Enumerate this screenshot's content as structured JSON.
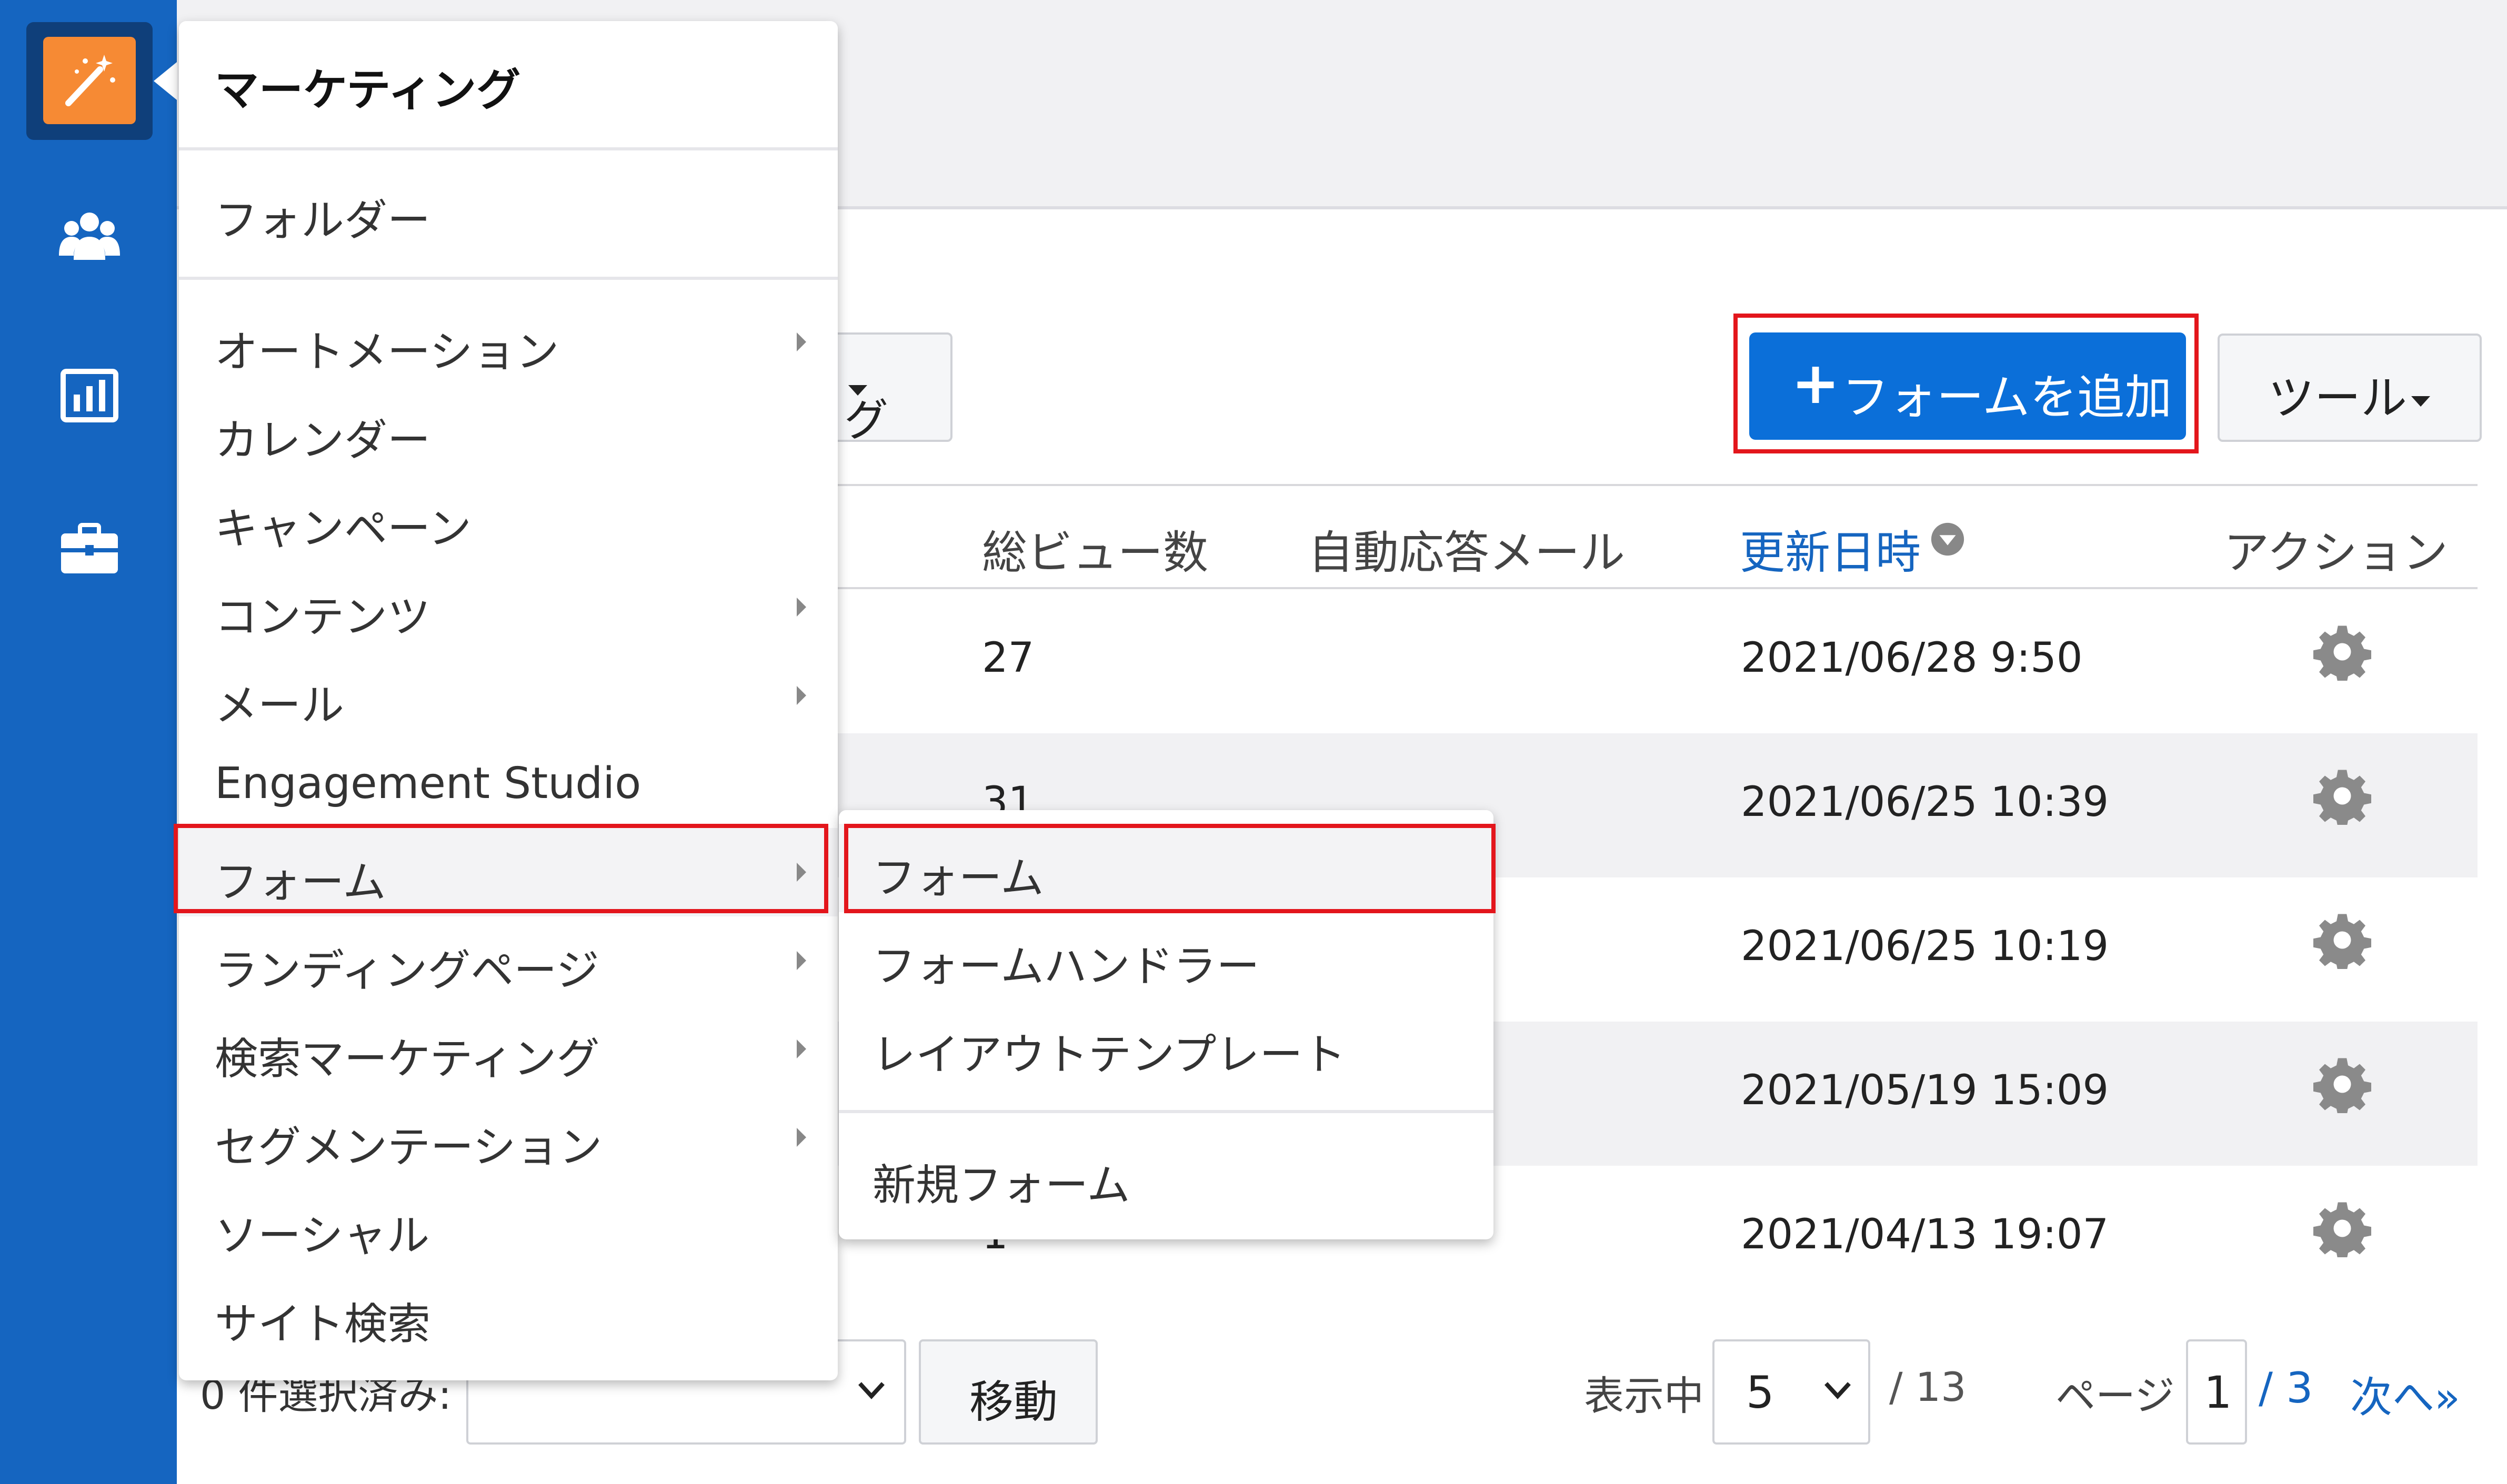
{
  "colors": {
    "rail": "#1565c0",
    "accent": "#0b6fd9",
    "logo": "#f68a34",
    "highlight": "#e3161c"
  },
  "rail": {
    "icons": [
      "marketing-wand-icon",
      "prospects-people-icon",
      "reports-chart-icon",
      "admin-briefcase-icon"
    ]
  },
  "toolbar": {
    "filter_tag_fragment": "グ",
    "add_form_plus": "+",
    "add_form_label": "フォームを追加",
    "tools_label": "ツール"
  },
  "table": {
    "headers": {
      "views": "総ビュー数",
      "autoresponder": "自動応答メール",
      "updated": "更新日時",
      "actions": "アクション"
    },
    "rows": [
      {
        "views": "27",
        "updated": "2021/06/28 9:50"
      },
      {
        "views": "31",
        "updated": "2021/06/25 10:39"
      },
      {
        "views": "",
        "updated": "2021/06/25 10:19"
      },
      {
        "views": "",
        "updated": "2021/05/19 15:09"
      },
      {
        "views": "1",
        "updated": "2021/04/13 19:07"
      }
    ]
  },
  "footer": {
    "selected_label": "0 件選択済み:",
    "move_label": "移動",
    "showing_label": "表示中",
    "per_page": "5",
    "total": "/ 13",
    "page_label": "ページ",
    "page_current": "1",
    "page_total": "/ 3",
    "next_label": "次へ»"
  },
  "menu": {
    "header": "マーケティング",
    "folders": "フォルダー",
    "items": [
      {
        "label": "オートメーション",
        "has_submenu": true
      },
      {
        "label": "カレンダー",
        "has_submenu": false
      },
      {
        "label": "キャンペーン",
        "has_submenu": false
      },
      {
        "label": "コンテンツ",
        "has_submenu": true
      },
      {
        "label": "メール",
        "has_submenu": true
      },
      {
        "label": "Engagement Studio",
        "has_submenu": false
      },
      {
        "label": "フォーム",
        "has_submenu": true,
        "selected": true
      },
      {
        "label": "ランディングページ",
        "has_submenu": true
      },
      {
        "label": "検索マーケティング",
        "has_submenu": true
      },
      {
        "label": "セグメンテーション",
        "has_submenu": true
      },
      {
        "label": "ソーシャル",
        "has_submenu": false
      },
      {
        "label": "サイト検索",
        "has_submenu": false
      }
    ]
  },
  "submenu": {
    "items": [
      "フォーム",
      "フォームハンドラー",
      "レイアウトテンプレート"
    ],
    "new_item": "新規フォーム"
  }
}
